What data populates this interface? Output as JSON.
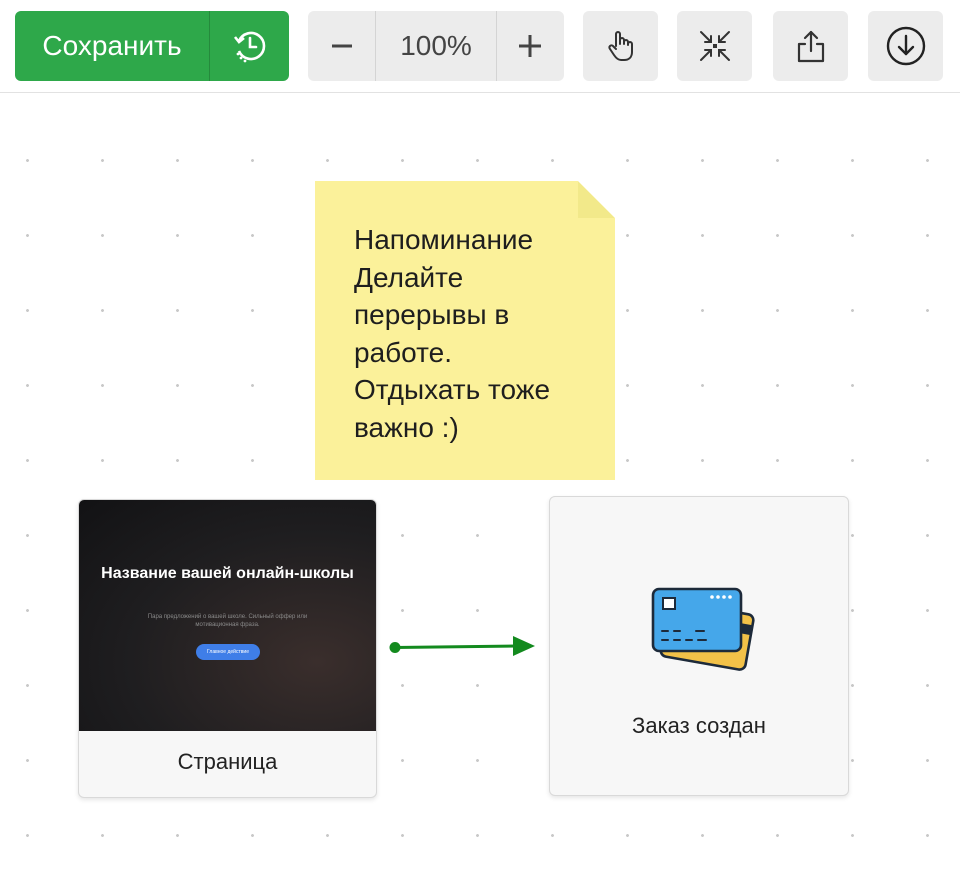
{
  "toolbar": {
    "save_label": "Сохранить",
    "zoom_value": "100%",
    "icons": {
      "history": "history-icon",
      "zoom_out": "minus-icon",
      "zoom_in": "plus-icon",
      "pan": "hand-pointer-icon",
      "fit": "compress-icon",
      "share": "share-icon",
      "download": "download-icon"
    }
  },
  "sticky_note": {
    "text": "Напоминание\nДелайте\nперерывы в\nработе.\nОтдыхать тоже\nважно :)",
    "color": "#fbf19a"
  },
  "nodes": {
    "page": {
      "label": "Страница",
      "preview_title": "Название вашей онлайн-школы",
      "preview_subtitle": "Пара предложений о вашей школе. Сильный оффер или мотивационная фраза.",
      "preview_button": "Главное действие"
    },
    "order": {
      "label": "Заказ создан",
      "icon": "credit-card-icon"
    }
  },
  "colors": {
    "save_green": "#2ea84a",
    "arrow_green": "#138a1e",
    "card_blue": "#45a7ea",
    "card_yellow": "#f2c148"
  }
}
